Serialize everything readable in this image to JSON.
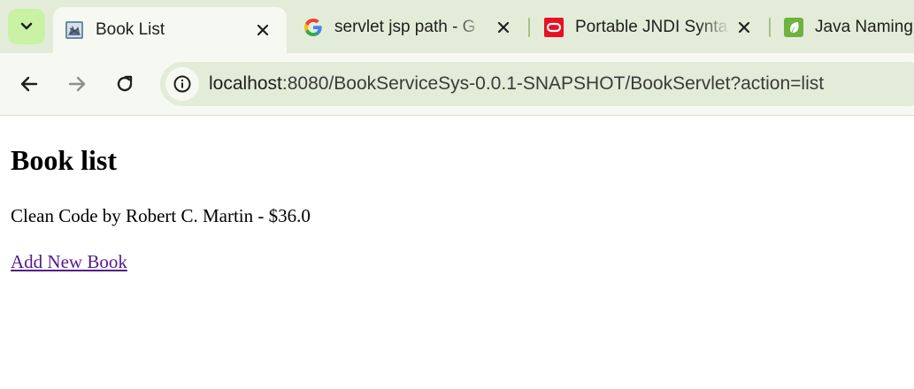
{
  "browser": {
    "tabs": [
      {
        "title": "Book List",
        "favicon": "tomcat-icon",
        "active": true
      },
      {
        "title": "servlet jsp path - G",
        "favicon": "google-icon",
        "active": false
      },
      {
        "title": "Portable JNDI Synta",
        "favicon": "oracle-icon",
        "active": false
      },
      {
        "title": "Java Naming",
        "favicon": "spring-icon",
        "active": false
      }
    ],
    "address_bar": {
      "host": "localhost",
      "path": ":8080/BookServiceSys-0.0.1-SNAPSHOT/BookServlet?action=list"
    },
    "colors": {
      "frame": "#e3ecd9",
      "toolbar": "#f6f9f1",
      "accent": "#c9f2a5"
    }
  },
  "page": {
    "heading": "Book list",
    "book_entry": "Clean Code by Robert C. Martin - $36.0",
    "add_link": "Add New Book"
  }
}
